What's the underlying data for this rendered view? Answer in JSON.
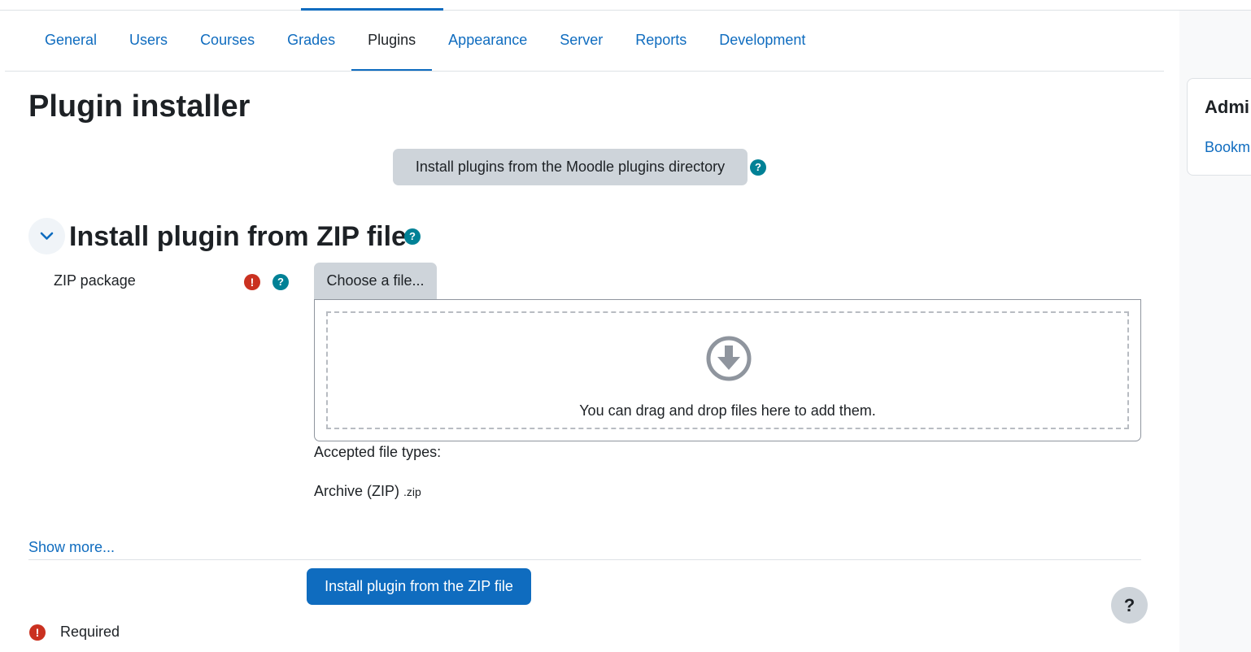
{
  "nav": {
    "tabs": [
      {
        "label": "General"
      },
      {
        "label": "Users"
      },
      {
        "label": "Courses"
      },
      {
        "label": "Grades"
      },
      {
        "label": "Plugins",
        "active": true
      },
      {
        "label": "Appearance"
      },
      {
        "label": "Server"
      },
      {
        "label": "Reports"
      },
      {
        "label": "Development"
      }
    ]
  },
  "page": {
    "title": "Plugin installer",
    "directory_button": "Install plugins from the Moodle plugins directory"
  },
  "section": {
    "title": "Install plugin from ZIP file"
  },
  "form": {
    "zip_label": "ZIP package",
    "choose_button": "Choose a file...",
    "dropzone_text": "You can drag and drop files here to add them.",
    "accepted_label": "Accepted file types:",
    "accepted_type_name": "Archive (ZIP)",
    "accepted_type_ext": ".zip",
    "show_more": "Show more...",
    "submit_button": "Install plugin from the ZIP file",
    "required_label": "Required"
  },
  "sidebar": {
    "block_title": "Admi",
    "block_link": "Bookm"
  },
  "glyphs": {
    "help": "?",
    "required": "!"
  },
  "icons": {
    "help": "question-circle-icon",
    "required": "exclamation-circle-icon",
    "collapse": "chevron-down-icon",
    "dropzone": "arrow-circle-down-icon"
  },
  "colors": {
    "accent": "#0f6cbf",
    "help_icon": "#008196",
    "required_icon": "#ca3120",
    "secondary_button": "#ced4da"
  }
}
